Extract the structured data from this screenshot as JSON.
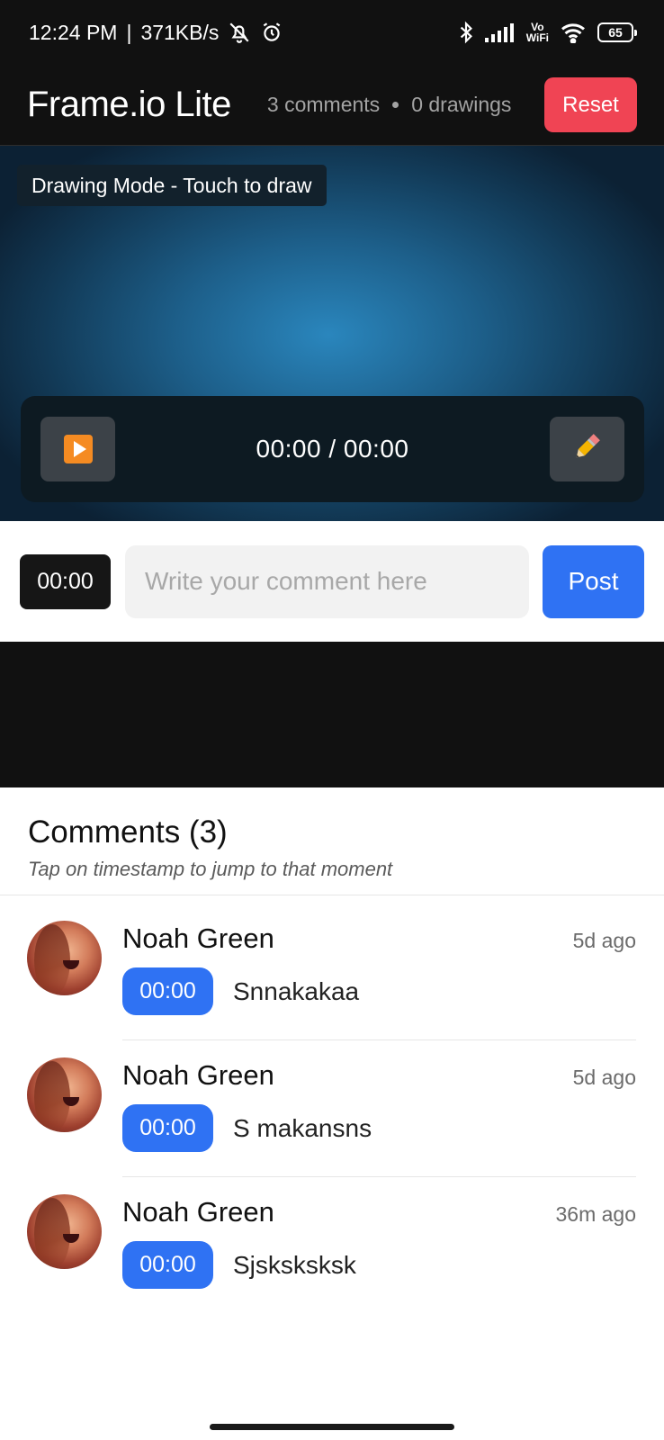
{
  "status_bar": {
    "time": "12:24 PM",
    "net_speed": "371KB/s",
    "vowifi_top": "Vo",
    "vowifi_bottom": "WiFi",
    "battery": "65"
  },
  "header": {
    "title": "Frame.io Lite",
    "comments_count": "3 comments",
    "drawings_count": "0 drawings",
    "reset_label": "Reset"
  },
  "video": {
    "mode_badge": "Drawing Mode - Touch to draw",
    "time_display": "00:00 / 00:00"
  },
  "composer": {
    "timestamp": "00:00",
    "placeholder": "Write your comment here",
    "post_label": "Post"
  },
  "comments_section": {
    "title": "Comments (3)",
    "hint": "Tap on timestamp to jump to that moment",
    "items": [
      {
        "author": "Noah Green",
        "time": "5d ago",
        "timestamp": "00:00",
        "text": "Snnakakaa"
      },
      {
        "author": "Noah Green",
        "time": "5d ago",
        "timestamp": "00:00",
        "text": "S makansns"
      },
      {
        "author": "Noah Green",
        "time": "36m ago",
        "timestamp": "00:00",
        "text": "Sjsksksksk"
      }
    ]
  },
  "colors": {
    "accent_blue": "#2f72f3",
    "reset_red": "#f04454",
    "dark_bg": "#111111"
  }
}
